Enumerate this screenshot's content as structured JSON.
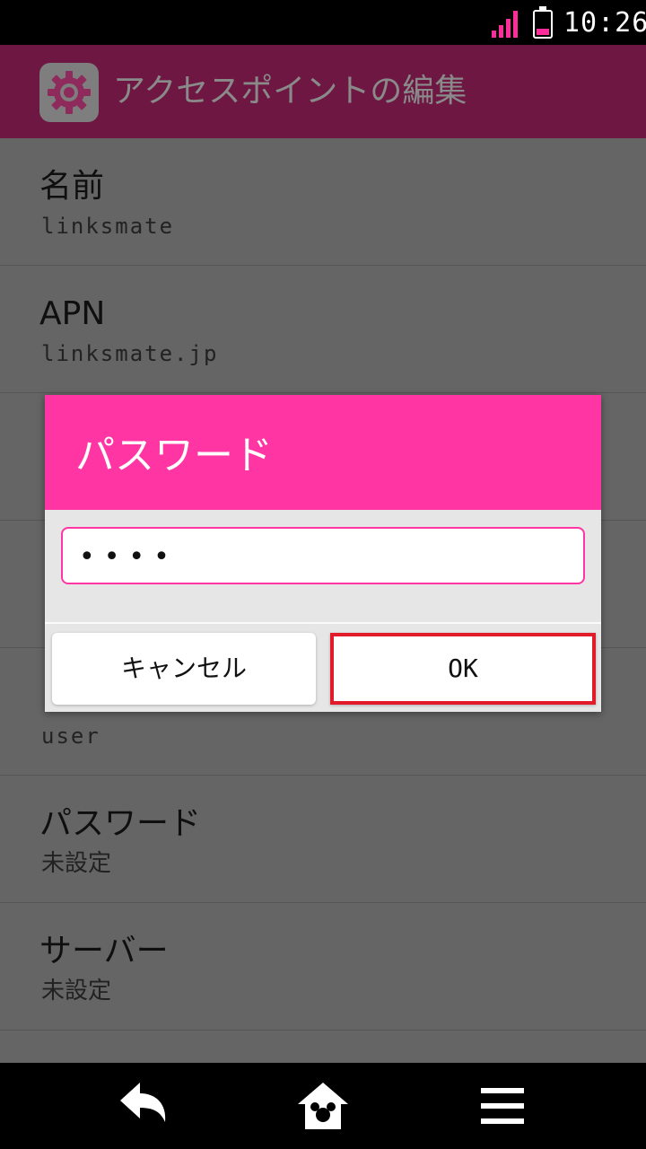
{
  "status": {
    "time": "10:26",
    "battery_level": 0.25,
    "accent_color": "#ff2d9a"
  },
  "app_bar": {
    "icon": "gear-icon",
    "title": "アクセスポイントの編集"
  },
  "list": {
    "items": [
      {
        "title": "名前",
        "value": "linksmate"
      },
      {
        "title": "APN",
        "value": "linksmate.jp"
      },
      {
        "title": "",
        "value": ""
      },
      {
        "title": "",
        "value": ""
      },
      {
        "title": "",
        "value": "user"
      },
      {
        "title": "パスワード",
        "value": "未設定"
      },
      {
        "title": "サーバー",
        "value": "未設定"
      }
    ]
  },
  "dialog": {
    "title": "パスワード",
    "input_value": "••••",
    "cancel_label": "キャンセル",
    "ok_label": "OK",
    "header_color": "#ff35a4",
    "highlight_color": "#e11b2a"
  },
  "nav": {
    "back_icon": "back-arrow-icon",
    "home_icon": "home-icon",
    "menu_icon": "menu-icon"
  }
}
